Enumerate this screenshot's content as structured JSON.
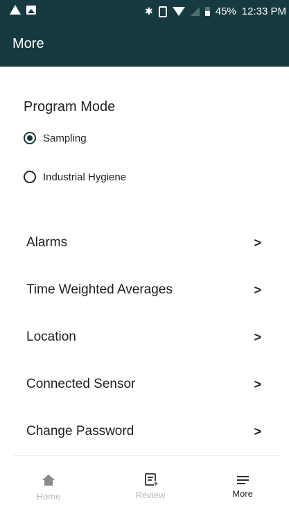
{
  "status_bar": {
    "battery": "45%",
    "time": "12:33 PM",
    "icons": [
      "warning-icon",
      "image-icon",
      "bluetooth-icon",
      "vibrate-icon",
      "wifi-icon",
      "signal-icon",
      "battery-icon"
    ]
  },
  "app_bar": {
    "title": "More",
    "background_color": "#173a40"
  },
  "program_mode": {
    "title": "Program Mode",
    "options": [
      {
        "label": "Sampling",
        "selected": true
      },
      {
        "label": "Industrial Hygiene",
        "selected": false
      }
    ]
  },
  "menu": {
    "items": [
      {
        "label": "Alarms",
        "icon": "chevron-right-icon"
      },
      {
        "label": "Time Weighted Averages",
        "icon": "chevron-right-icon"
      },
      {
        "label": "Location",
        "icon": "chevron-right-icon"
      },
      {
        "label": "Connected Sensor",
        "icon": "chevron-right-icon"
      },
      {
        "label": "Change Password",
        "icon": "chevron-right-icon"
      }
    ]
  },
  "bottom_nav": {
    "items": [
      {
        "label": "Home",
        "icon": "home-icon",
        "active": false
      },
      {
        "label": "Review",
        "icon": "review-icon",
        "active": false
      },
      {
        "label": "More",
        "icon": "menu-icon",
        "active": true
      }
    ]
  }
}
